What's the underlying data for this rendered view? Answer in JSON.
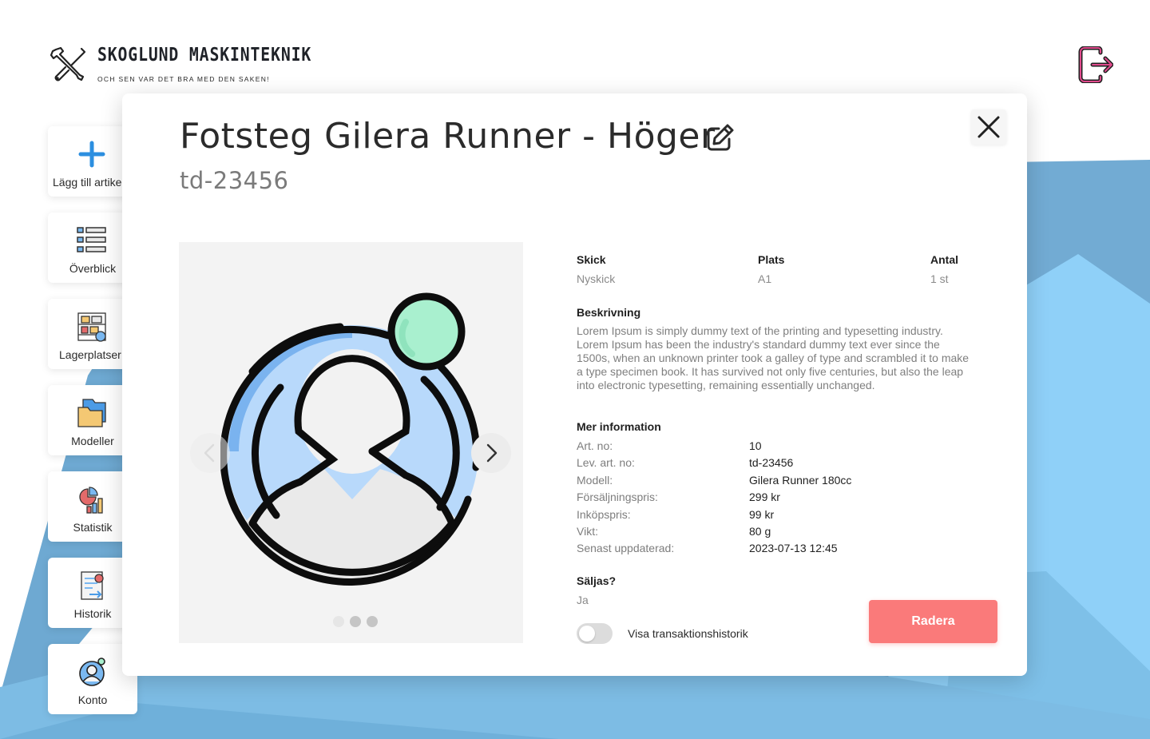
{
  "brand": {
    "title": "SKOGLUND MASKINTEKNIK",
    "tagline": "OCH SEN VAR DET BRA MED DEN SAKEN!",
    "logo_icon": "crossed-tools-icon"
  },
  "header": {
    "logout_icon": "logout-icon",
    "accent_color": "#c2185b"
  },
  "sidebar": {
    "items": [
      {
        "label": "Lägg till artikel",
        "icon": "plus-icon"
      },
      {
        "label": "Överblick",
        "icon": "list-icon"
      },
      {
        "label": "Lagerplatser",
        "icon": "warehouse-shelf-icon"
      },
      {
        "label": "Modeller",
        "icon": "folder-icon"
      },
      {
        "label": "Statistik",
        "icon": "statistics-icon"
      },
      {
        "label": "Historik",
        "icon": "history-icon"
      },
      {
        "label": "Konto",
        "icon": "account-icon"
      }
    ]
  },
  "modal": {
    "title": "Fotsteg Gilera Runner - Höger",
    "subtitle": "td-23456",
    "gallery": {
      "image_count": 3,
      "active_index": 0
    },
    "facts": [
      {
        "label": "Skick",
        "value": "Nyskick"
      },
      {
        "label": "Plats",
        "value": "A1"
      },
      {
        "label": "Antal",
        "value": "1 st"
      }
    ],
    "description_label": "Beskrivning",
    "description": "Lorem Ipsum is simply dummy text of the printing and typesetting industry. Lorem Ipsum has been the industry's standard dummy text ever since the 1500s, when an unknown printer took a galley of type and scrambled it to make a type specimen book. It has survived not only five centuries, but also the leap into electronic typesetting, remaining essentially unchanged.",
    "more_info_label": "Mer information",
    "more_info": [
      {
        "key": "Art. no:",
        "value": "10"
      },
      {
        "key": "Lev. art. no:",
        "value": "td-23456"
      },
      {
        "key": "Modell:",
        "value": "Gilera Runner 180cc"
      },
      {
        "key": "Försäljningspris:",
        "value": "299 kr"
      },
      {
        "key": "Inköpspris:",
        "value": "99 kr"
      },
      {
        "key": "Vikt:",
        "value": "80 g"
      },
      {
        "key": "Senast uppdaterad:",
        "value": "2023-07-13 12:45"
      }
    ],
    "for_sale_label": "Säljas?",
    "for_sale_value": "Ja",
    "toggle_label": "Visa transaktionshistorik",
    "toggle_on": false,
    "delete_label": "Radera",
    "delete_color": "#fa7a7a"
  },
  "colors": {
    "bg_blue_light": "#86cdf6",
    "bg_blue_mid": "#76b8e0",
    "bg_blue_dark": "#5f9ecd"
  }
}
